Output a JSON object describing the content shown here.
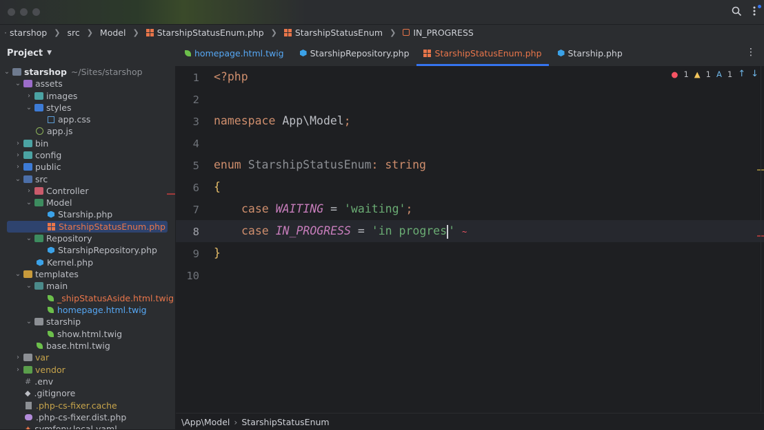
{
  "titlebar": {
    "search_icon": "search-icon",
    "more_icon": "kebab-icon"
  },
  "breadcrumb": [
    "starshop",
    "src",
    "Model",
    "StarshipStatusEnum.php",
    "StarshipStatusEnum",
    "IN_PROGRESS"
  ],
  "project": {
    "label": "Project",
    "root_name": "starshop",
    "root_path": "~/Sites/starshop",
    "tree": [
      {
        "label": "assets"
      },
      {
        "label": "images"
      },
      {
        "label": "styles"
      },
      {
        "label": "app.css"
      },
      {
        "label": "app.js"
      },
      {
        "label": "bin"
      },
      {
        "label": "config"
      },
      {
        "label": "public"
      },
      {
        "label": "src"
      },
      {
        "label": "Controller"
      },
      {
        "label": "Model"
      },
      {
        "label": "Starship.php"
      },
      {
        "label": "StarshipStatusEnum.php"
      },
      {
        "label": "Repository"
      },
      {
        "label": "StarshipRepository.php"
      },
      {
        "label": "Kernel.php"
      },
      {
        "label": "templates"
      },
      {
        "label": "main"
      },
      {
        "label": "_shipStatusAside.html.twig"
      },
      {
        "label": "homepage.html.twig"
      },
      {
        "label": "starship"
      },
      {
        "label": "show.html.twig"
      },
      {
        "label": "base.html.twig"
      },
      {
        "label": "var"
      },
      {
        "label": "vendor"
      },
      {
        "label": ".env"
      },
      {
        "label": ".gitignore"
      },
      {
        "label": ".php-cs-fixer.cache"
      },
      {
        "label": ".php-cs-fixer.dist.php"
      },
      {
        "label": "symfony.local.yaml"
      }
    ]
  },
  "tabs": [
    {
      "label": "homepage.html.twig"
    },
    {
      "label": "StarshipRepository.php"
    },
    {
      "label": "StarshipStatusEnum.php"
    },
    {
      "label": "Starship.php"
    }
  ],
  "inspections": {
    "errors": "1",
    "warnings": "1",
    "typos": "1"
  },
  "editor": {
    "line_numbers": [
      "1",
      "2",
      "3",
      "4",
      "5",
      "6",
      "7",
      "8",
      "9",
      "10"
    ],
    "code": {
      "l1": "<?php",
      "l3_kw": "namespace",
      "l3_ns": "App\\Model",
      "l3_semi": ";",
      "l5_kw": "enum",
      "l5_name": "StarshipStatusEnum",
      "l5_colon": ":",
      "l5_type": "string",
      "l6": "{",
      "l7_kw": "case",
      "l7_const": "WAITING",
      "l7_eq": " = ",
      "l7_str": "'waiting'",
      "l7_semi": ";",
      "l8_kw": "case",
      "l8_const": "IN_PROGRESS",
      "l8_eq": " = ",
      "l8_str": "'in progres",
      "l8_quote": "'",
      "l9": "}"
    }
  },
  "footer": [
    "\\App\\Model",
    "StarshipStatusEnum"
  ]
}
